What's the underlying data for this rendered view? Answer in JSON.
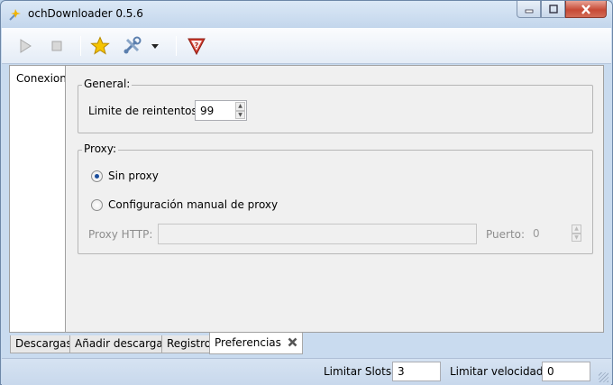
{
  "window": {
    "title": "ochDownloader 0.5.6"
  },
  "toolbar": {
    "icons": [
      "play-icon",
      "stop-icon",
      "star-icon",
      "tools-icon",
      "dropdown-arrow-icon",
      "help-shield-icon"
    ]
  },
  "sidebar": {
    "tab_label": "Conexion"
  },
  "general": {
    "title": "General:",
    "retries_label": "Limite de reintentos",
    "retries_value": "99"
  },
  "proxy": {
    "title": "Proxy:",
    "option_none": "Sin proxy",
    "option_manual": "Configuración manual de proxy",
    "selected": "Sin proxy",
    "http_label": "Proxy HTTP:",
    "http_value": "",
    "port_label": "Puerto:",
    "port_value": "0"
  },
  "tabs": [
    {
      "label": "Descargas"
    },
    {
      "label": "Añadir descargas"
    },
    {
      "label": "Registro"
    },
    {
      "label": "Preferencias",
      "active": true
    }
  ],
  "status": {
    "slots_label": "Limitar Slots",
    "slots_value": "3",
    "speed_label": "Limitar velocidad",
    "speed_value": "0"
  },
  "colors": {
    "accent": "#1c4e9c",
    "help_red": "#d23a2c",
    "star": "#f5c400"
  }
}
